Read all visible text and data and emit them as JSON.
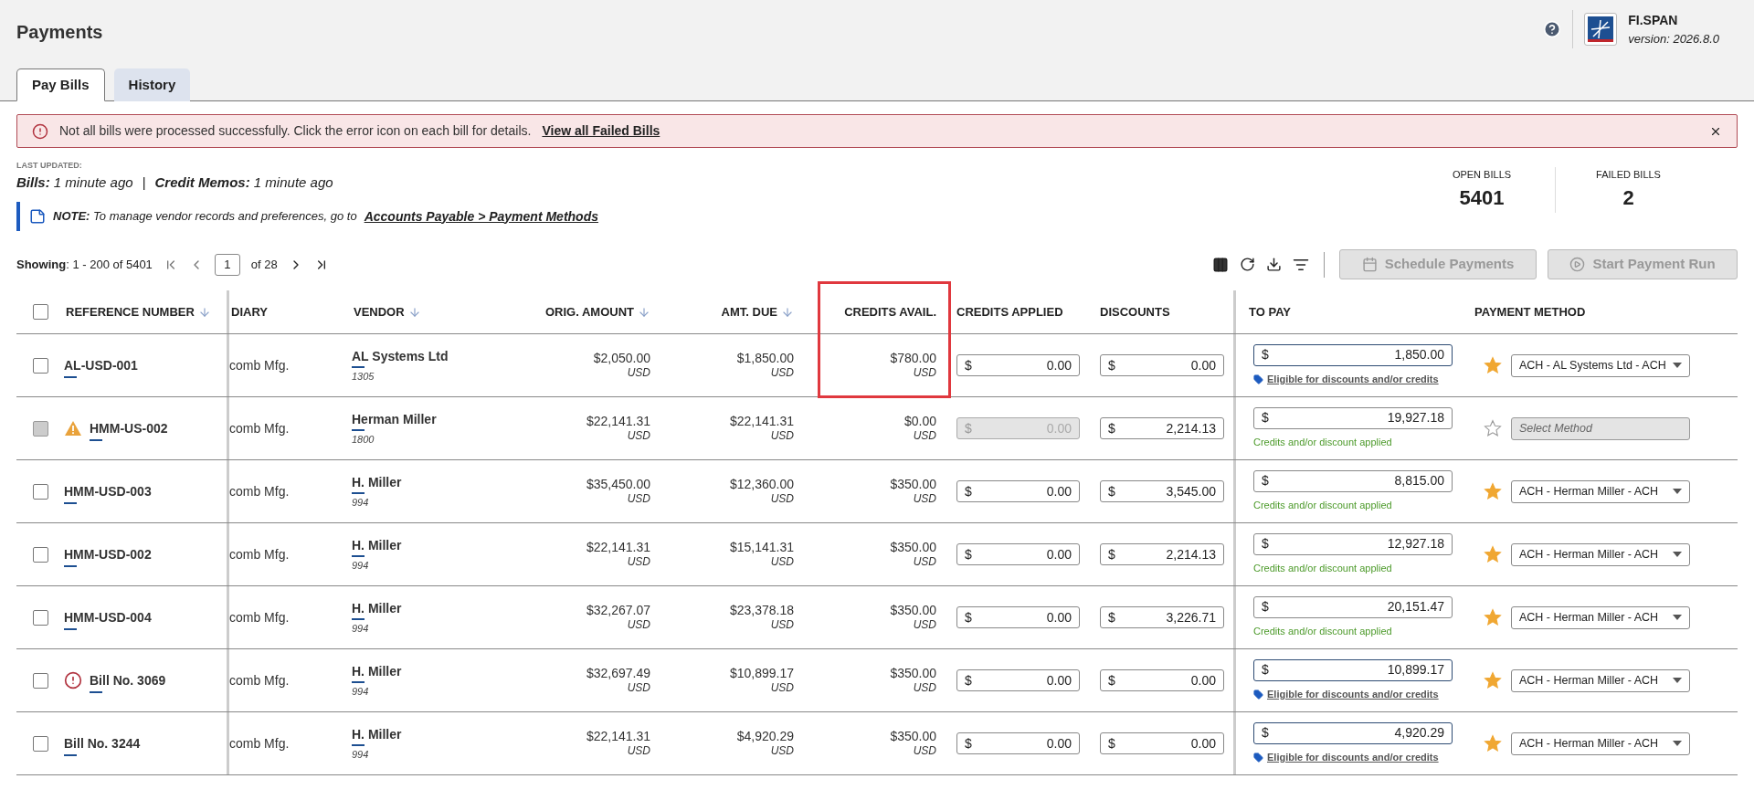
{
  "page_title": "Payments",
  "brand": {
    "name": "FI.SPAN",
    "version": "version: 2026.8.0"
  },
  "tabs": [
    {
      "label": "Pay Bills",
      "selected": true
    },
    {
      "label": "History",
      "selected": false
    }
  ],
  "alert": {
    "message": "Not all bills were processed successfully. Click the error icon on each bill for details.",
    "link": "View all Failed Bills"
  },
  "last_updated": {
    "label": "LAST UPDATED:",
    "bills": "**Bills:** 1 minute ago",
    "separator": "|",
    "credit_memos": "**Credit Memos:** 1 minute ago"
  },
  "note": {
    "text": "**NOTE:** To manage vendor records and preferences, go to",
    "link": "Accounts Payable > Payment Methods"
  },
  "stats": [
    {
      "label": "OPEN BILLS",
      "value": "5401"
    },
    {
      "label": "FAILED BILLS",
      "value": "2"
    }
  ],
  "pagination": {
    "showing": "**Showing**: 1 - 200 of 5401",
    "page": "1",
    "of": "of 28"
  },
  "actions": [
    {
      "label": "Schedule Payments",
      "kind": "calendar",
      "disabled": true
    },
    {
      "label": "Start Payment Run",
      "kind": "play",
      "disabled": true
    }
  ],
  "select_all": {
    "checked": false
  },
  "columns": [
    {
      "label": "REFERENCE NUMBER",
      "sortable": true
    },
    {
      "label": "DIARY",
      "sortable": false
    },
    {
      "label": "VENDOR",
      "sortable": true
    },
    {
      "label": "ORIG. AMOUNT",
      "sortable": true
    },
    {
      "label": "AMT. DUE",
      "sortable": true
    },
    {
      "label": "CREDITS AVAIL.",
      "sortable": false
    },
    {
      "label": "CREDITS APPLIED",
      "sortable": false
    },
    {
      "label": "DISCOUNTS",
      "sortable": false
    },
    {
      "label": "TO PAY",
      "sortable": false
    },
    {
      "label": "PAYMENT METHOD",
      "sortable": false
    }
  ],
  "rows": [
    {
      "checkbox_disabled": false,
      "kind": "normal",
      "reference": "AL-USD-001",
      "diary": "comb Mfg.",
      "vendor": "AL Systems Ltd",
      "vendor_id": "1305",
      "orig_amount": "$2,050.00",
      "orig_currency": "USD",
      "amt_due": "$1,850.00",
      "due_currency": "USD",
      "credits_avail": "$780.00",
      "avail_currency": "USD",
      "credits_applied": {
        "symbol": "$",
        "value": "0.00",
        "disabled": false
      },
      "discounts": {
        "symbol": "$",
        "value": "0.00"
      },
      "to_pay": {
        "symbol": "$",
        "value": "1,850.00",
        "emphasized": true
      },
      "note": {
        "kind": "eligible",
        "text": "Eligible for discounts and/or credits"
      },
      "payment_method": {
        "value": "ACH - AL Systems Ltd - ACH",
        "starred": true,
        "disabled": false
      }
    },
    {
      "checkbox_disabled": true,
      "kind": "warning",
      "reference": "HMM-US-002",
      "diary": "comb Mfg.",
      "vendor": "Herman Miller",
      "vendor_id": "1800",
      "orig_amount": "$22,141.31",
      "orig_currency": "USD",
      "amt_due": "$22,141.31",
      "due_currency": "USD",
      "credits_avail": "$0.00",
      "avail_currency": "USD",
      "credits_applied": {
        "symbol": "$",
        "value": "0.00",
        "disabled": true
      },
      "discounts": {
        "symbol": "$",
        "value": "2,214.13"
      },
      "to_pay": {
        "symbol": "$",
        "value": "19,927.18",
        "emphasized": false
      },
      "note": {
        "kind": "applied",
        "text": "Credits and/or discount applied"
      },
      "payment_method": {
        "placeholder": "Select Method",
        "starred": false,
        "disabled": true
      }
    },
    {
      "checkbox_disabled": false,
      "kind": "normal",
      "reference": "HMM-USD-003",
      "diary": "comb Mfg.",
      "vendor": "H. Miller",
      "vendor_id": "994",
      "orig_amount": "$35,450.00",
      "orig_currency": "USD",
      "amt_due": "$12,360.00",
      "due_currency": "USD",
      "credits_avail": "$350.00",
      "avail_currency": "USD",
      "credits_applied": {
        "symbol": "$",
        "value": "0.00",
        "disabled": false
      },
      "discounts": {
        "symbol": "$",
        "value": "3,545.00"
      },
      "to_pay": {
        "symbol": "$",
        "value": "8,815.00",
        "emphasized": false
      },
      "note": {
        "kind": "applied",
        "text": "Credits and/or discount applied"
      },
      "payment_method": {
        "value": "ACH - Herman Miller - ACH",
        "starred": true,
        "disabled": false
      }
    },
    {
      "checkbox_disabled": false,
      "kind": "normal",
      "reference": "HMM-USD-002",
      "diary": "comb Mfg.",
      "vendor": "H. Miller",
      "vendor_id": "994",
      "orig_amount": "$22,141.31",
      "orig_currency": "USD",
      "amt_due": "$15,141.31",
      "due_currency": "USD",
      "credits_avail": "$350.00",
      "avail_currency": "USD",
      "credits_applied": {
        "symbol": "$",
        "value": "0.00",
        "disabled": false
      },
      "discounts": {
        "symbol": "$",
        "value": "2,214.13"
      },
      "to_pay": {
        "symbol": "$",
        "value": "12,927.18",
        "emphasized": false
      },
      "note": {
        "kind": "applied",
        "text": "Credits and/or discount applied"
      },
      "payment_method": {
        "value": "ACH - Herman Miller - ACH",
        "starred": true,
        "disabled": false
      }
    },
    {
      "checkbox_disabled": false,
      "kind": "normal",
      "reference": "HMM-USD-004",
      "diary": "comb Mfg.",
      "vendor": "H. Miller",
      "vendor_id": "994",
      "orig_amount": "$32,267.07",
      "orig_currency": "USD",
      "amt_due": "$23,378.18",
      "due_currency": "USD",
      "credits_avail": "$350.00",
      "avail_currency": "USD",
      "credits_applied": {
        "symbol": "$",
        "value": "0.00",
        "disabled": false
      },
      "discounts": {
        "symbol": "$",
        "value": "3,226.71"
      },
      "to_pay": {
        "symbol": "$",
        "value": "20,151.47",
        "emphasized": false
      },
      "note": {
        "kind": "applied",
        "text": "Credits and/or discount applied"
      },
      "payment_method": {
        "value": "ACH - Herman Miller - ACH",
        "starred": true,
        "disabled": false
      }
    },
    {
      "checkbox_disabled": false,
      "kind": "error",
      "reference": "Bill No. 3069",
      "diary": "comb Mfg.",
      "vendor": "H. Miller",
      "vendor_id": "994",
      "orig_amount": "$32,697.49",
      "orig_currency": "USD",
      "amt_due": "$10,899.17",
      "due_currency": "USD",
      "credits_avail": "$350.00",
      "avail_currency": "USD",
      "credits_applied": {
        "symbol": "$",
        "value": "0.00",
        "disabled": false
      },
      "discounts": {
        "symbol": "$",
        "value": "0.00"
      },
      "to_pay": {
        "symbol": "$",
        "value": "10,899.17",
        "emphasized": true
      },
      "note": {
        "kind": "eligible",
        "text": "Eligible for discounts and/or credits"
      },
      "payment_method": {
        "value": "ACH - Herman Miller - ACH",
        "starred": true,
        "disabled": false
      }
    },
    {
      "checkbox_disabled": false,
      "kind": "normal",
      "reference": "Bill No. 3244",
      "diary": "comb Mfg.",
      "vendor": "H. Miller",
      "vendor_id": "994",
      "orig_amount": "$22,141.31",
      "orig_currency": "USD",
      "amt_due": "$4,920.29",
      "due_currency": "USD",
      "credits_avail": "$350.00",
      "avail_currency": "USD",
      "credits_applied": {
        "symbol": "$",
        "value": "0.00",
        "disabled": false
      },
      "discounts": {
        "symbol": "$",
        "value": "0.00"
      },
      "to_pay": {
        "symbol": "$",
        "value": "4,920.29",
        "emphasized": true
      },
      "note": {
        "kind": "eligible",
        "text": "Eligible for discounts and/or credits"
      },
      "payment_method": {
        "value": "ACH - Herman Miller - ACH",
        "starred": true,
        "disabled": false
      }
    }
  ]
}
